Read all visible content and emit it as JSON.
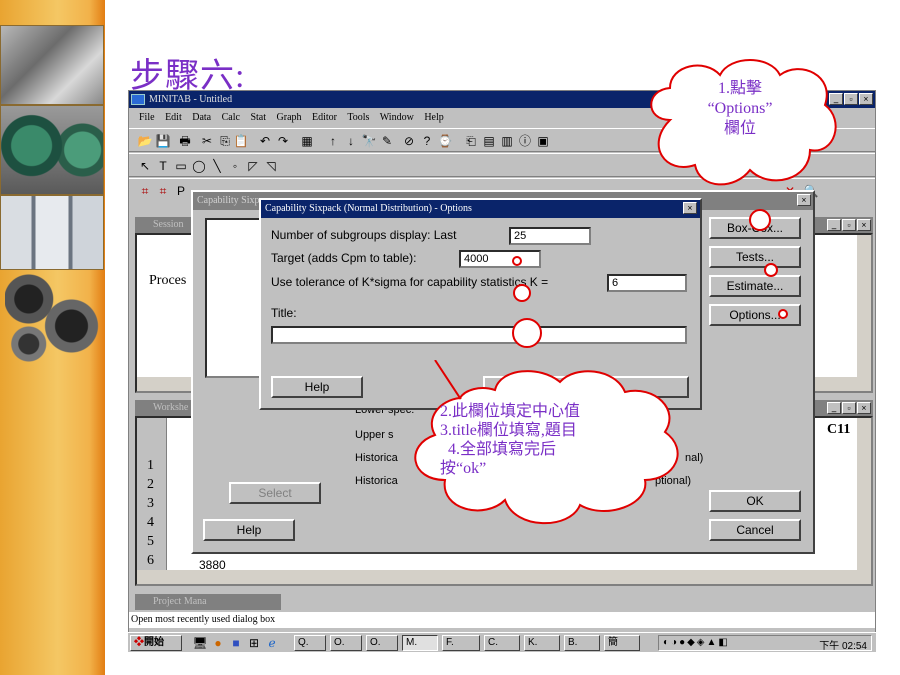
{
  "slide": {
    "title": "步驟六:"
  },
  "app": {
    "window_title": "MINITAB - Untitled",
    "menu": [
      "File",
      "Edit",
      "Data",
      "Calc",
      "Stat",
      "Graph",
      "Editor",
      "Tools",
      "Window",
      "Help"
    ],
    "session_title": "Session",
    "session_text": "Proces",
    "worksheet_title": "Workshe",
    "worksheet_col_header": "C11",
    "row_numbers": [
      "1",
      "2",
      "3",
      "4",
      "5",
      "6"
    ],
    "partial_cell": "3880",
    "project_manager": "Project Mana",
    "status": "Open most recently used dialog box"
  },
  "capability_dialog": {
    "title": "Capability Sixp",
    "lower_spec": "Lower spec:",
    "upper_spec": "Upper s",
    "historical1": "Historica",
    "historical2": "Historica",
    "optional1": "nal)",
    "optional2": "ptional)",
    "select_label": "Select",
    "help_label": "Help",
    "box_cox_label": "Box-Cox...",
    "tests_label": "Tests...",
    "estimate_label": "Estimate...",
    "options_label": "Options...",
    "ok_label": "OK",
    "cancel_label": "Cancel"
  },
  "options_dialog": {
    "title": "Capability Sixpack (Normal Distribution) - Options",
    "subgroups_label": "Number of subgroups display:  Last",
    "subgroups_value": "25",
    "target_label": "Target (adds Cpm to table):",
    "target_value": "4000",
    "tolerance_label": "Use tolerance of K*sigma for capability statistics   K =",
    "k_value": "6",
    "title_label": "Title:",
    "title_value": "",
    "help_label": "Help"
  },
  "taskbar": {
    "start_label": "開始",
    "tasks": [
      "Q.",
      "O.",
      "O.",
      "M.",
      "F.",
      "C.",
      "K.",
      "B.",
      "簡"
    ],
    "clock": "下午 02:54"
  },
  "callouts": {
    "callout1": [
      "1.點擊",
      "“Options”",
      "欄位"
    ],
    "callout2": [
      "2.此欄位填定中心值",
      "3.title欄位填寫,題目",
      "4.全部填寫完后",
      "按“ok”"
    ]
  },
  "colors": {
    "accent": "#7a2fc6",
    "marker": "#e00000",
    "titlebar": "#0a246a",
    "sidebar": "#f2b24a"
  }
}
